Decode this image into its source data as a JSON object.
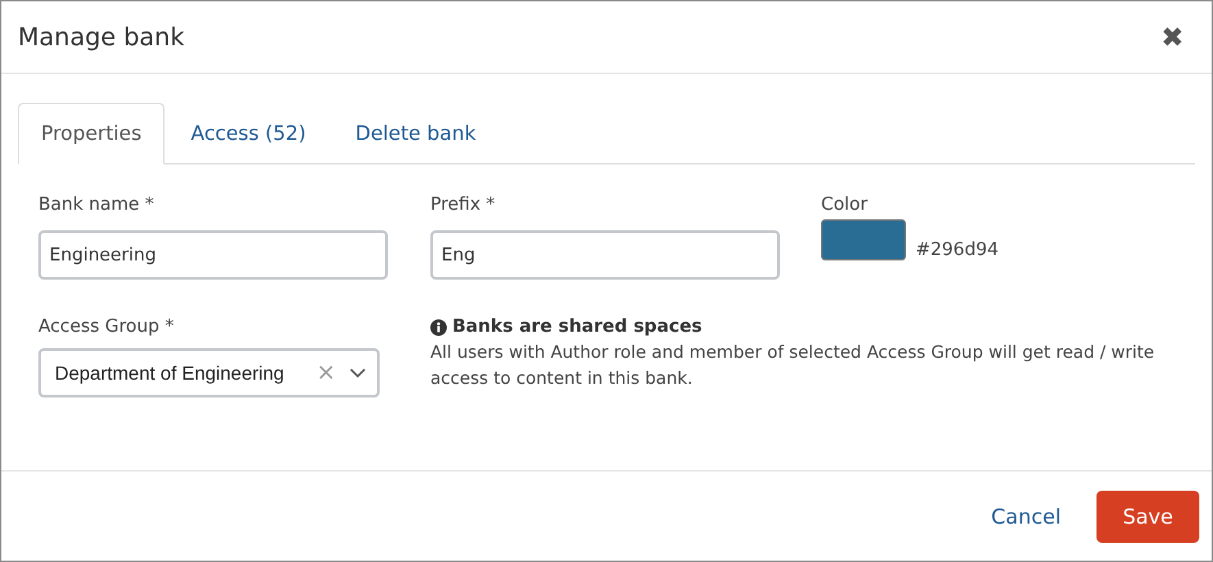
{
  "window": {
    "title": "Manage bank",
    "close": "✖"
  },
  "tabs": [
    {
      "label": "Properties",
      "selected": true
    },
    {
      "label": "Access (52)",
      "selected": false
    },
    {
      "label": "Delete bank",
      "selected": false
    }
  ],
  "bank_name": {
    "label": "Bank name *",
    "value": "Engineering"
  },
  "prefix": {
    "label": "Prefix *",
    "value": "Eng"
  },
  "color": {
    "label": "Color",
    "value": "#296d94",
    "color": "#296d94"
  },
  "access_group": {
    "label": "Access Group *",
    "value": "Department of Engineering",
    "clear": "×"
  },
  "notice": {
    "title": "Banks are shared spaces",
    "text": "All users with Author role and member of selected Access Group will get read / write access to content in this bank."
  },
  "buttons": [
    {
      "label": "Cancel",
      "kind": "link"
    },
    {
      "label": "Save",
      "kind": "primary"
    }
  ]
}
